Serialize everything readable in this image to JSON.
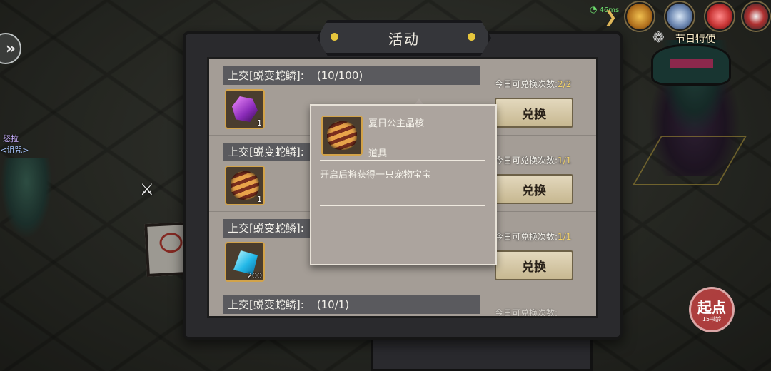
{
  "status": {
    "signal": "46ms"
  },
  "hud": {
    "festival_label": "节日特使",
    "icons": [
      "treasure-chest-icon",
      "sword-shield-icon",
      "gift-icon",
      "camera-icon",
      "balloon-icon"
    ]
  },
  "left_side": {
    "back_icon": "double-chevron-icon",
    "npc_name": "怒拉",
    "npc_subtitle": "<诅咒>",
    "sword_icon": "crossed-swords-icon"
  },
  "panel": {
    "title": "活动",
    "rows": [
      {
        "header_label": "上交[蜕变蛇鳞]:",
        "progress": "(10/100)",
        "item": "purple-crystal",
        "count": "1",
        "limit_label": "今日可兑换次数:",
        "limit_count": "2/2",
        "button": "兑换"
      },
      {
        "header_label": "上交[蜕变蛇鳞]:",
        "progress": "",
        "item": "summer-princess-core",
        "count": "1",
        "limit_label": "今日可兑换次数:",
        "limit_count": "1/1",
        "button": "兑换"
      },
      {
        "header_label": "上交[蜕变蛇鳞]:",
        "progress": "",
        "item": "blue-diamond",
        "count": "200",
        "limit_label": "今日可兑换次数:",
        "limit_count": "1/1",
        "button": "兑换"
      },
      {
        "header_label": "上交[蜕变蛇鳞]:",
        "progress": "(10/1)",
        "item": "",
        "count": "",
        "limit_label": "今日可兑换次数:",
        "limit_count": "",
        "button": ""
      }
    ]
  },
  "tooltip": {
    "item_name": "夏日公主晶核",
    "item_type": "道具",
    "description": "开启后将获得一只宠物宝宝"
  },
  "badge": {
    "title": "起点",
    "subtitle": "15书龄"
  },
  "colors": {
    "accent_gold": "#e6c63c",
    "panel_bg": "#a49d96",
    "limit_count": "#f4d36a"
  }
}
